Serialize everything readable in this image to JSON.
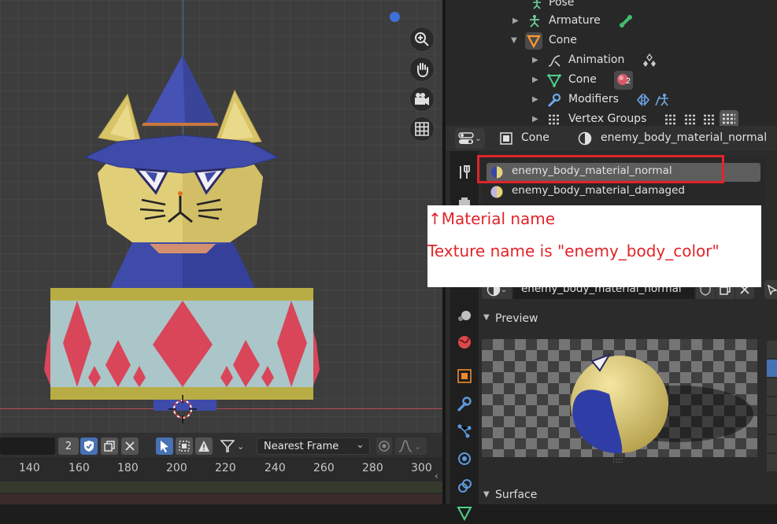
{
  "timeline": {
    "frame_value": "2",
    "snap_label": "Nearest Frame",
    "ticks": [
      "140",
      "160",
      "180",
      "200",
      "220",
      "240",
      "260",
      "280",
      "300"
    ]
  },
  "outliner": {
    "rows": [
      {
        "label": "Pose"
      },
      {
        "label": "Armature"
      },
      {
        "label": "Cone"
      },
      {
        "label": "Animation"
      },
      {
        "label": "Cone"
      },
      {
        "label": "Modifiers"
      },
      {
        "label": "Vertex Groups"
      }
    ],
    "users_badge": "2"
  },
  "properties": {
    "object_name": "Cone",
    "material_name": "enemy_body_material_normal",
    "slots": [
      {
        "label": "enemy_body_material_normal"
      },
      {
        "label": "enemy_body_material_damaged"
      }
    ],
    "material_field": "enemy_body_material_normal",
    "preview_label": "Preview",
    "surface_label": "Surface"
  },
  "annotation": {
    "line1": "↑Material name",
    "line2": "Texture name is \"enemy_body_color\""
  },
  "colors": {
    "accent_blue": "#4772b3",
    "annotation_red": "#e0242a"
  }
}
